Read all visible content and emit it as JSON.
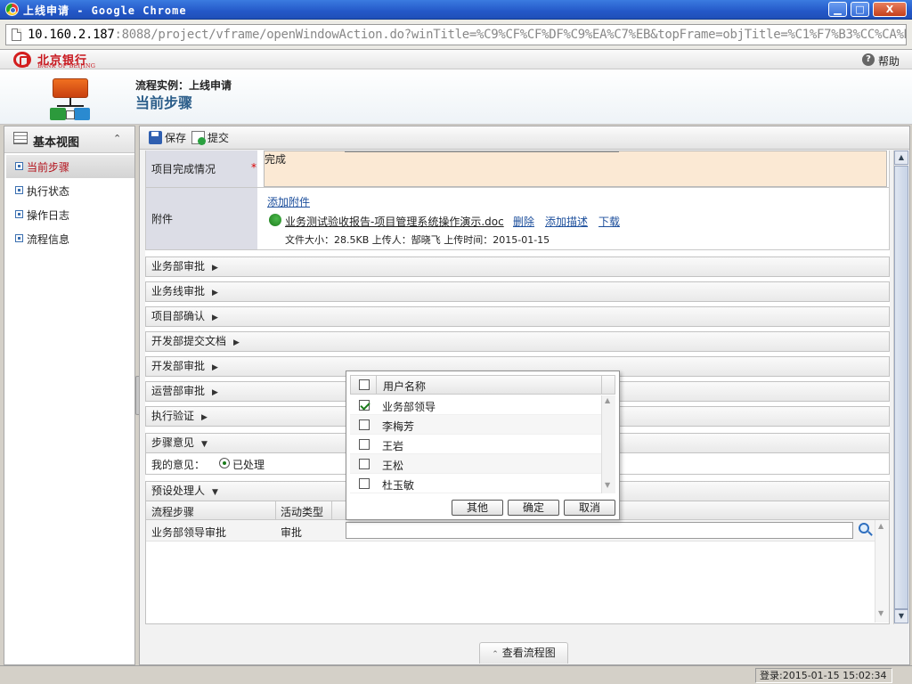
{
  "window": {
    "title": "上线申请 - Google Chrome",
    "controls": {
      "minimize": "▁",
      "maximize": "□",
      "close": "X"
    }
  },
  "address_bar": {
    "host": "10.160.2.187",
    "rest": ":8088/project/vframe/openWindowAction.do?winTitle=%C9%CF%CF%DF%C9%EA%C7%EB&topFrame=objTitle=%C1%F7%B3%CC%CA%B5"
  },
  "brand": {
    "name_cn": "北京银行",
    "name_en": "BANK OF BEIJING",
    "help_label": "帮助"
  },
  "header": {
    "flow_instance": "流程实例：上线申请",
    "current_step": "当前步骤"
  },
  "sidebar": {
    "title": "基本视图",
    "collapse_icon": "chevrons-up-icon",
    "items": [
      {
        "label": "当前步骤",
        "active": true
      },
      {
        "label": "执行状态",
        "active": false
      },
      {
        "label": "操作日志",
        "active": false
      },
      {
        "label": "流程信息",
        "active": false
      }
    ]
  },
  "toolbar": {
    "save_label": "保存",
    "submit_label": "提交"
  },
  "form": {
    "completion": {
      "label": "项目完成情况",
      "required_mark": "*",
      "value": "完成"
    },
    "attachment": {
      "label": "附件",
      "add_link": "添加附件",
      "file_name": "业务测试验收报告-项目管理系统操作演示.doc",
      "delete_link": "删除",
      "add_desc_link": "添加描述",
      "download_link": "下载",
      "meta": "文件大小：28.5KB 上传人：郜晓飞 上传时间：2015-01-15"
    }
  },
  "sections": [
    {
      "label": "业务部审批",
      "arrow": "▶"
    },
    {
      "label": "业务线审批",
      "arrow": "▶"
    },
    {
      "label": "项目部确认",
      "arrow": "▶"
    },
    {
      "label": "开发部提交文档",
      "arrow": "▶"
    },
    {
      "label": "开发部审批",
      "arrow": "▶"
    },
    {
      "label": "运营部审批",
      "arrow": "▶"
    },
    {
      "label": "执行验证",
      "arrow": "▶"
    }
  ],
  "opinion": {
    "section_label": "步骤意见",
    "arrow": "▼",
    "my_opinion_label": "我的意见：",
    "option": "已处理"
  },
  "handlers": {
    "section_label": "预设处理人",
    "arrow": "▼",
    "columns": [
      "流程步骤",
      "活动类型"
    ],
    "rows": [
      {
        "step": "业务部领导审批",
        "type": "审批",
        "handler": ""
      }
    ]
  },
  "user_picker": {
    "header": "用户名称",
    "users": [
      {
        "name": "业务部领导",
        "checked": true
      },
      {
        "name": "李梅芳",
        "checked": false
      },
      {
        "name": "王岩",
        "checked": false
      },
      {
        "name": "王松",
        "checked": false
      },
      {
        "name": "杜玉敏",
        "checked": false
      }
    ],
    "buttons": {
      "other": "其他",
      "ok": "确定",
      "cancel": "取消"
    }
  },
  "footer": {
    "view_flow_label": "查看流程图",
    "login_status": "登录:2015-01-15 15:02:34"
  },
  "colors": {
    "brand_red": "#c8161d",
    "active_item": "#b3101a",
    "link_blue": "#1d4f9c",
    "title_bar_blue": "#2458c8",
    "textarea_bg": "#fbe9d4"
  }
}
